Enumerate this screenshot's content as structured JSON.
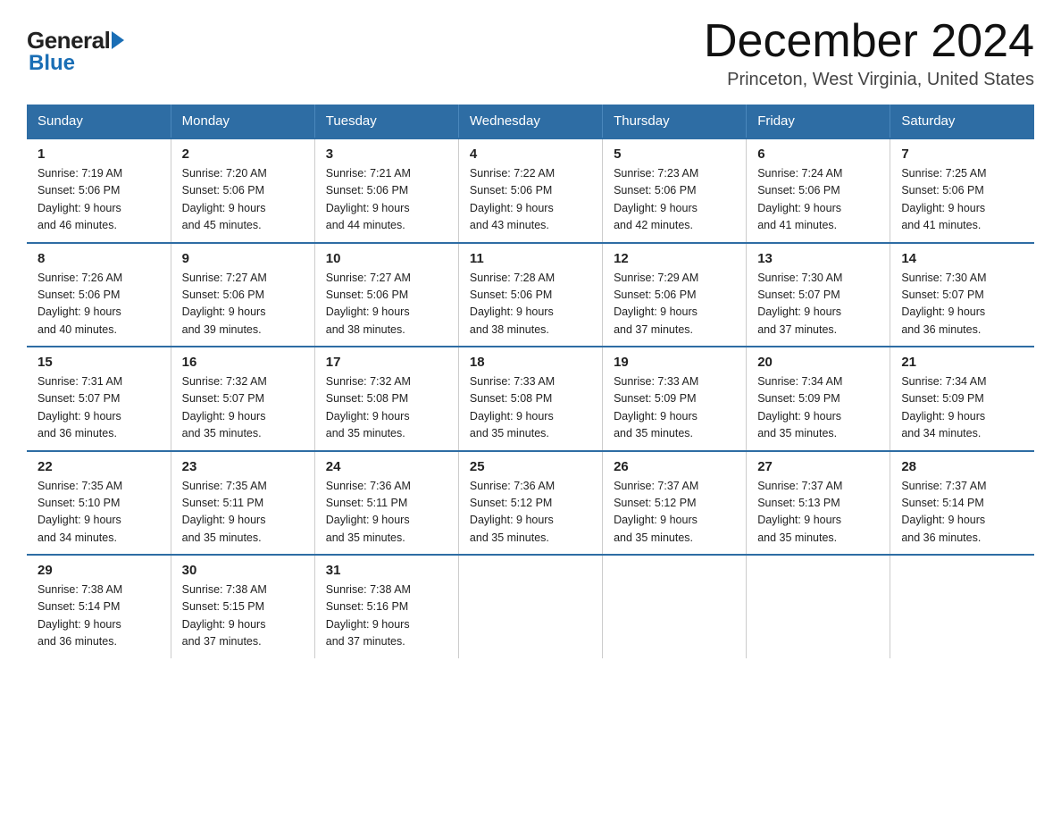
{
  "logo": {
    "general_text": "General",
    "blue_text": "Blue"
  },
  "header": {
    "month_year": "December 2024",
    "location": "Princeton, West Virginia, United States"
  },
  "days_of_week": [
    "Sunday",
    "Monday",
    "Tuesday",
    "Wednesday",
    "Thursday",
    "Friday",
    "Saturday"
  ],
  "weeks": [
    [
      {
        "day": "1",
        "sunrise": "7:19 AM",
        "sunset": "5:06 PM",
        "daylight": "9 hours and 46 minutes."
      },
      {
        "day": "2",
        "sunrise": "7:20 AM",
        "sunset": "5:06 PM",
        "daylight": "9 hours and 45 minutes."
      },
      {
        "day": "3",
        "sunrise": "7:21 AM",
        "sunset": "5:06 PM",
        "daylight": "9 hours and 44 minutes."
      },
      {
        "day": "4",
        "sunrise": "7:22 AM",
        "sunset": "5:06 PM",
        "daylight": "9 hours and 43 minutes."
      },
      {
        "day": "5",
        "sunrise": "7:23 AM",
        "sunset": "5:06 PM",
        "daylight": "9 hours and 42 minutes."
      },
      {
        "day": "6",
        "sunrise": "7:24 AM",
        "sunset": "5:06 PM",
        "daylight": "9 hours and 41 minutes."
      },
      {
        "day": "7",
        "sunrise": "7:25 AM",
        "sunset": "5:06 PM",
        "daylight": "9 hours and 41 minutes."
      }
    ],
    [
      {
        "day": "8",
        "sunrise": "7:26 AM",
        "sunset": "5:06 PM",
        "daylight": "9 hours and 40 minutes."
      },
      {
        "day": "9",
        "sunrise": "7:27 AM",
        "sunset": "5:06 PM",
        "daylight": "9 hours and 39 minutes."
      },
      {
        "day": "10",
        "sunrise": "7:27 AM",
        "sunset": "5:06 PM",
        "daylight": "9 hours and 38 minutes."
      },
      {
        "day": "11",
        "sunrise": "7:28 AM",
        "sunset": "5:06 PM",
        "daylight": "9 hours and 38 minutes."
      },
      {
        "day": "12",
        "sunrise": "7:29 AM",
        "sunset": "5:06 PM",
        "daylight": "9 hours and 37 minutes."
      },
      {
        "day": "13",
        "sunrise": "7:30 AM",
        "sunset": "5:07 PM",
        "daylight": "9 hours and 37 minutes."
      },
      {
        "day": "14",
        "sunrise": "7:30 AM",
        "sunset": "5:07 PM",
        "daylight": "9 hours and 36 minutes."
      }
    ],
    [
      {
        "day": "15",
        "sunrise": "7:31 AM",
        "sunset": "5:07 PM",
        "daylight": "9 hours and 36 minutes."
      },
      {
        "day": "16",
        "sunrise": "7:32 AM",
        "sunset": "5:07 PM",
        "daylight": "9 hours and 35 minutes."
      },
      {
        "day": "17",
        "sunrise": "7:32 AM",
        "sunset": "5:08 PM",
        "daylight": "9 hours and 35 minutes."
      },
      {
        "day": "18",
        "sunrise": "7:33 AM",
        "sunset": "5:08 PM",
        "daylight": "9 hours and 35 minutes."
      },
      {
        "day": "19",
        "sunrise": "7:33 AM",
        "sunset": "5:09 PM",
        "daylight": "9 hours and 35 minutes."
      },
      {
        "day": "20",
        "sunrise": "7:34 AM",
        "sunset": "5:09 PM",
        "daylight": "9 hours and 35 minutes."
      },
      {
        "day": "21",
        "sunrise": "7:34 AM",
        "sunset": "5:09 PM",
        "daylight": "9 hours and 34 minutes."
      }
    ],
    [
      {
        "day": "22",
        "sunrise": "7:35 AM",
        "sunset": "5:10 PM",
        "daylight": "9 hours and 34 minutes."
      },
      {
        "day": "23",
        "sunrise": "7:35 AM",
        "sunset": "5:11 PM",
        "daylight": "9 hours and 35 minutes."
      },
      {
        "day": "24",
        "sunrise": "7:36 AM",
        "sunset": "5:11 PM",
        "daylight": "9 hours and 35 minutes."
      },
      {
        "day": "25",
        "sunrise": "7:36 AM",
        "sunset": "5:12 PM",
        "daylight": "9 hours and 35 minutes."
      },
      {
        "day": "26",
        "sunrise": "7:37 AM",
        "sunset": "5:12 PM",
        "daylight": "9 hours and 35 minutes."
      },
      {
        "day": "27",
        "sunrise": "7:37 AM",
        "sunset": "5:13 PM",
        "daylight": "9 hours and 35 minutes."
      },
      {
        "day": "28",
        "sunrise": "7:37 AM",
        "sunset": "5:14 PM",
        "daylight": "9 hours and 36 minutes."
      }
    ],
    [
      {
        "day": "29",
        "sunrise": "7:38 AM",
        "sunset": "5:14 PM",
        "daylight": "9 hours and 36 minutes."
      },
      {
        "day": "30",
        "sunrise": "7:38 AM",
        "sunset": "5:15 PM",
        "daylight": "9 hours and 37 minutes."
      },
      {
        "day": "31",
        "sunrise": "7:38 AM",
        "sunset": "5:16 PM",
        "daylight": "9 hours and 37 minutes."
      },
      null,
      null,
      null,
      null
    ]
  ],
  "labels": {
    "sunrise": "Sunrise:",
    "sunset": "Sunset:",
    "daylight": "Daylight:"
  }
}
